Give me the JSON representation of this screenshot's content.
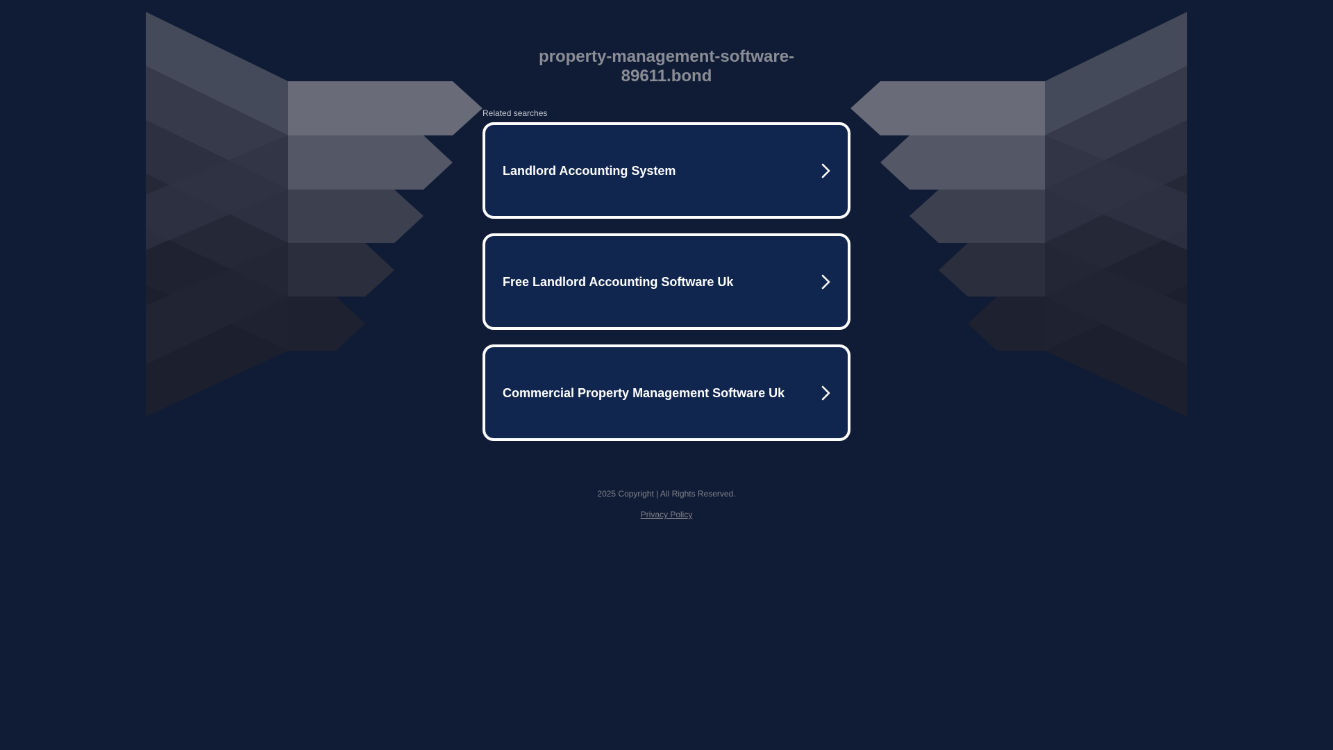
{
  "header": {
    "domain": "property-management-software-89611.bond"
  },
  "related": {
    "label": "Related searches",
    "items": [
      {
        "label": "Landlord Accounting System"
      },
      {
        "label": "Free Landlord Accounting Software Uk"
      },
      {
        "label": "Commercial Property Management Software Uk"
      }
    ]
  },
  "footer": {
    "copyright": "2025 Copyright | All Rights Reserved.",
    "privacy": "Privacy Policy"
  },
  "colors": {
    "background": "#101c36",
    "card_background": "#10264f",
    "card_border": "#ffffff",
    "title_text": "#8a8d94",
    "footer_text": "#7f8189"
  },
  "icons": {
    "result_arrow": "chevron-right-icon"
  }
}
